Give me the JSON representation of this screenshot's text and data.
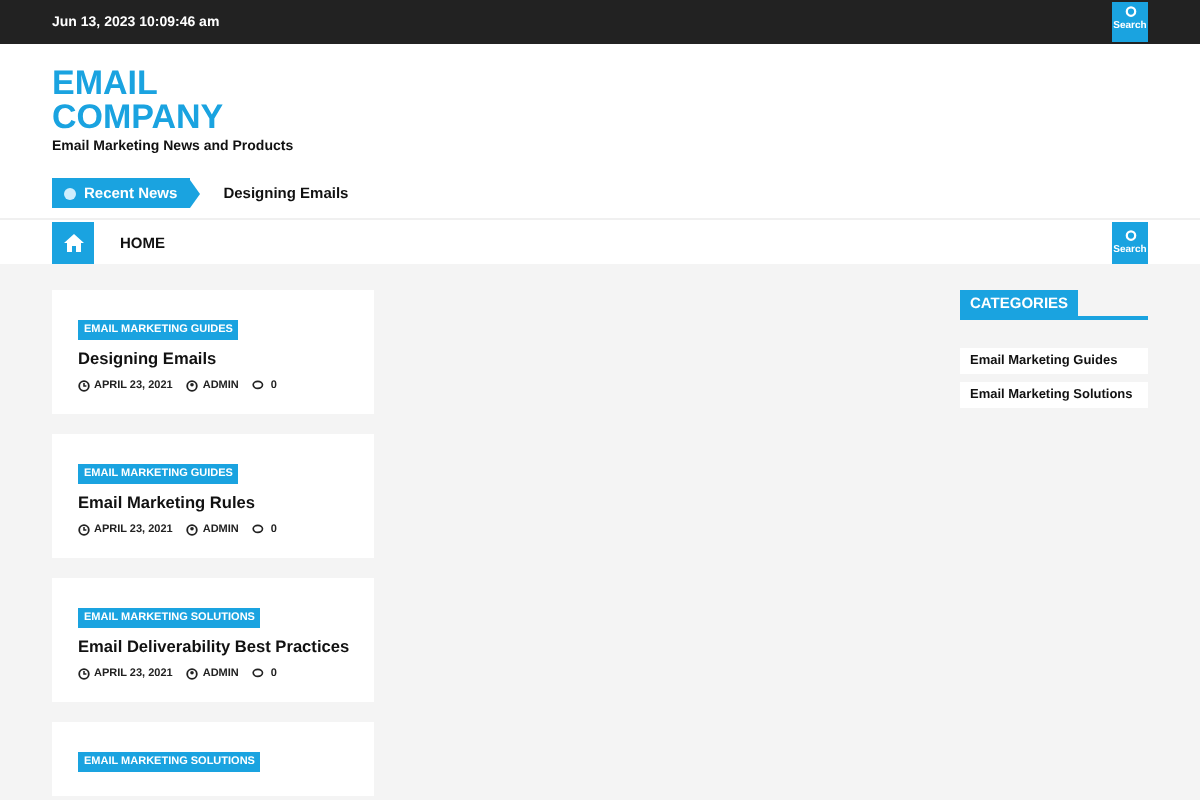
{
  "top_bar": {
    "datetime": "Jun 13, 2023 10:09:46 am",
    "search_label": "Search"
  },
  "header": {
    "site_title": "EMAIL COMPANY",
    "tagline": "Email Marketing News and Products",
    "ticker_label": "Recent News",
    "ticker_item": "Designing Emails"
  },
  "nav": {
    "items": [
      {
        "label": "HOME",
        "selected": false
      }
    ],
    "search_label": "Search"
  },
  "posts": [
    {
      "category": "EMAIL MARKETING GUIDES",
      "title": "Designing Emails",
      "date": "APRIL 23, 2021",
      "author": "ADMIN",
      "comments": "0"
    },
    {
      "category": "EMAIL MARKETING GUIDES",
      "title": "Email Marketing Rules",
      "date": "APRIL 23, 2021",
      "author": "ADMIN",
      "comments": "0"
    },
    {
      "category": "EMAIL MARKETING SOLUTIONS",
      "title": "Email Deliverability Best Practices",
      "date": "APRIL 23, 2021",
      "author": "ADMIN",
      "comments": "0"
    },
    {
      "category": "EMAIL MARKETING SOLUTIONS"
    }
  ],
  "sidebar": {
    "heading": "CATEGORIES",
    "items": [
      "Email Marketing Guides",
      "Email Marketing Solutions"
    ]
  }
}
